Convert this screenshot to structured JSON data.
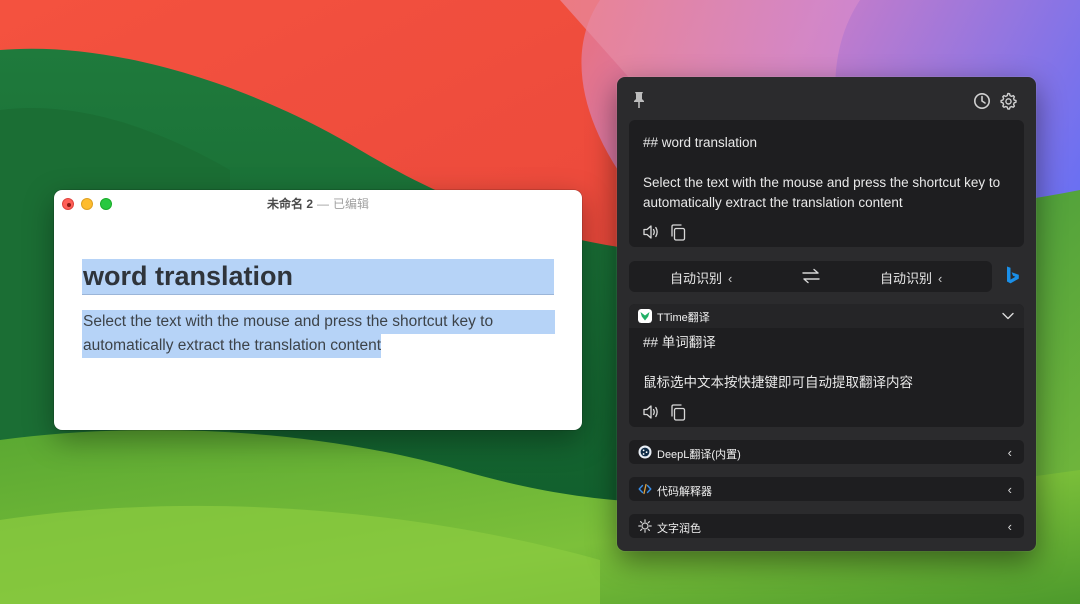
{
  "editor": {
    "title": "未命名 2",
    "title_sep": "—",
    "status": "已编辑",
    "heading": "word translation",
    "body_line1": "Select the text with the mouse and press the shortcut key to",
    "body_line2": "automatically extract the translation content"
  },
  "panel": {
    "source": {
      "line1": "## word translation",
      "line2": "Select the text with the mouse and press the shortcut key to automatically extract the translation content"
    },
    "lang_from": "自动识别",
    "lang_to": "自动识别",
    "lang_chevron": "‹",
    "services": [
      {
        "name": "TTime翻译",
        "expanded": true,
        "line1": "## 单词翻译",
        "line2": "鼠标选中文本按快捷键即可自动提取翻译内容"
      },
      {
        "name": "DeepL翻译(内置)",
        "expanded": false
      },
      {
        "name": "代码解释器",
        "expanded": false
      },
      {
        "name": "文字润色",
        "expanded": false
      }
    ],
    "row_chevron": "‹"
  },
  "colors": {
    "selection": "#b6d3f7",
    "panel_bg": "#2b2b2d",
    "card_bg": "#1e1e20",
    "bing_blue": "#1a8fe8",
    "ttime_green": "#21b066"
  }
}
